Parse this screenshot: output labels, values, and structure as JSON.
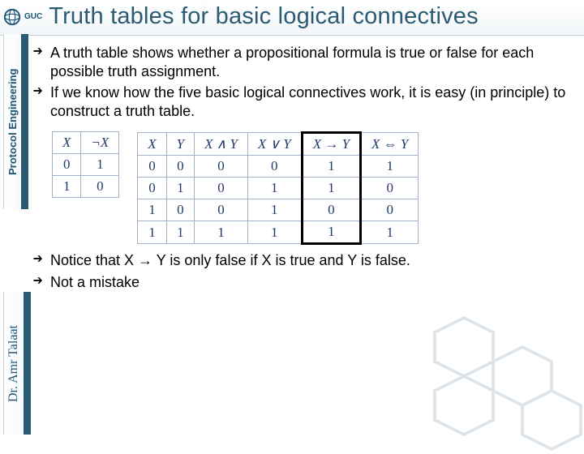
{
  "header": {
    "logo_text": "GUC",
    "title": "Truth tables for basic logical connectives"
  },
  "sidebar": {
    "course": "Protocol Engineering",
    "author": "Dr. Amr Talaat"
  },
  "bullets_top": [
    "A truth table shows whether a propositional formula is true or false for each possible truth assignment.",
    "If we know how the five basic logical connectives work, it is easy (in principle) to construct a truth table."
  ],
  "bullets_bottom": [
    "Notice that  X → Y is only false if X is true and Y is false.",
    "Not a mistake"
  ],
  "neg_table": {
    "headers": [
      "X",
      "¬X"
    ],
    "rows": [
      [
        "0",
        "1"
      ],
      [
        "1",
        "0"
      ]
    ]
  },
  "big_table": {
    "headers": [
      "X",
      "Y",
      "X ∧ Y",
      "X ∨ Y",
      "X → Y",
      "X ⇔ Y"
    ],
    "rows": [
      [
        "0",
        "0",
        "0",
        "0",
        "1",
        "1"
      ],
      [
        "0",
        "1",
        "0",
        "1",
        "1",
        "0"
      ],
      [
        "1",
        "0",
        "0",
        "1",
        "0",
        "0"
      ],
      [
        "1",
        "1",
        "1",
        "1",
        "1",
        "1"
      ]
    ]
  }
}
